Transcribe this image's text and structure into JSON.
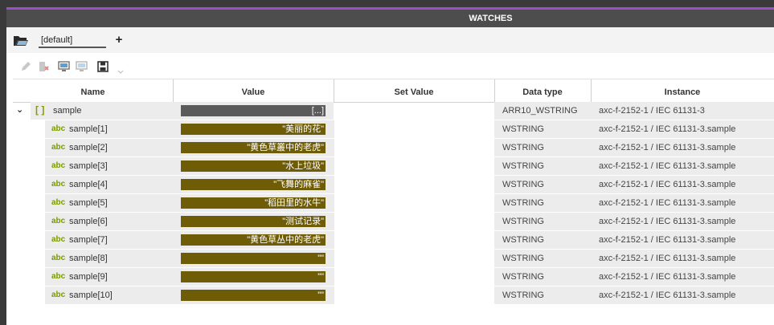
{
  "panel": {
    "title": "WATCHES"
  },
  "watch_tabs": {
    "active": "[default]",
    "add_label": "+"
  },
  "toolbar": {
    "icons": [
      "pencil-icon",
      "delete-variable-icon",
      "monitor-import-icon",
      "monitor-export-icon",
      "save-icon",
      "dropdown-arrow-icon"
    ]
  },
  "columns": [
    "Name",
    "Value",
    "Set Value",
    "Data type",
    "Instance"
  ],
  "rows": [
    {
      "name": "sample",
      "value": "[...]",
      "type": "ARR10_WSTRING",
      "instance": "axc-f-2152-1 / IEC 61131-3"
    },
    {
      "name": "sample[1]",
      "value": "\"美丽的花\"",
      "type": "WSTRING",
      "instance": "axc-f-2152-1 / IEC 61131-3.sample"
    },
    {
      "name": "sample[2]",
      "value": "\"黄色草叢中的老虎\"",
      "type": "WSTRING",
      "instance": "axc-f-2152-1 / IEC 61131-3.sample"
    },
    {
      "name": "sample[3]",
      "value": "\"水上垃圾\"",
      "type": "WSTRING",
      "instance": "axc-f-2152-1 / IEC 61131-3.sample"
    },
    {
      "name": "sample[4]",
      "value": "\"飞舞的麻雀\"",
      "type": "WSTRING",
      "instance": "axc-f-2152-1 / IEC 61131-3.sample"
    },
    {
      "name": "sample[5]",
      "value": "\"稻田里的水牛\"",
      "type": "WSTRING",
      "instance": "axc-f-2152-1 / IEC 61131-3.sample"
    },
    {
      "name": "sample[6]",
      "value": "\"测试记录\"",
      "type": "WSTRING",
      "instance": "axc-f-2152-1 / IEC 61131-3.sample"
    },
    {
      "name": "sample[7]",
      "value": "\"黄色草丛中的老虎\"",
      "type": "WSTRING",
      "instance": "axc-f-2152-1 / IEC 61131-3.sample"
    },
    {
      "name": "sample[8]",
      "value": "\"\"",
      "type": "WSTRING",
      "instance": "axc-f-2152-1 / IEC 61131-3.sample"
    },
    {
      "name": "sample[9]",
      "value": "\"\"",
      "type": "WSTRING",
      "instance": "axc-f-2152-1 / IEC 61131-3.sample"
    },
    {
      "name": "sample[10]",
      "value": "\"\"",
      "type": "WSTRING",
      "instance": "axc-f-2152-1 / IEC 61131-3.sample"
    }
  ],
  "labels": {
    "array_bracket": "[ ]",
    "string_type_badge": "abc",
    "expander": "⌄"
  },
  "colors": {
    "accent": "#9b4fc4",
    "header_bg": "#4d4d4d",
    "value_fill": "#6f5c06",
    "array_value_fill": "#5b5b5b",
    "type_badge": "#7a9a00"
  }
}
